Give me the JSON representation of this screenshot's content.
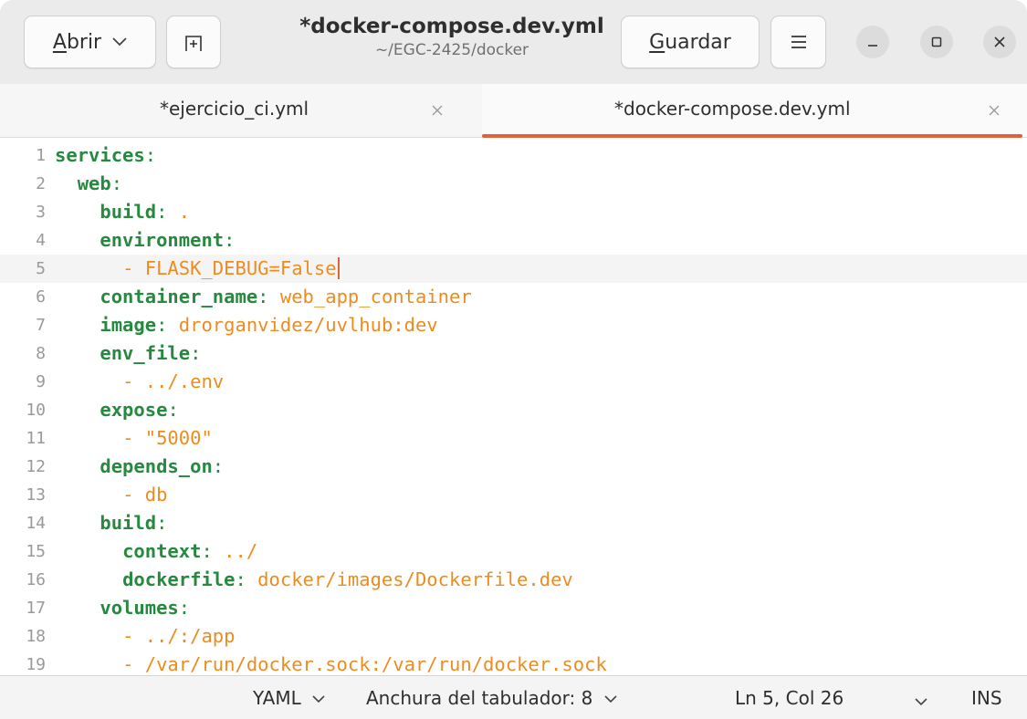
{
  "header": {
    "open_label_accel": "A",
    "open_label_rest": "brir",
    "title": "*docker-compose.dev.yml",
    "subtitle": "~/EGC-2425/docker",
    "save_label_accel": "G",
    "save_label_rest": "uardar",
    "icons": [
      "chevron-down-icon",
      "new-tab-icon",
      "hamburger-menu-icon",
      "minimize-icon",
      "maximize-icon",
      "close-icon"
    ]
  },
  "tabs": [
    {
      "label": "*ejercicio_ci.yml",
      "active": false
    },
    {
      "label": "*docker-compose.dev.yml",
      "active": true
    }
  ],
  "editor": {
    "current_line": 5,
    "lines": [
      {
        "n": "1",
        "indent": "",
        "key": "services",
        "colon": ":",
        "value": ""
      },
      {
        "n": "2",
        "indent": "  ",
        "key": "web",
        "colon": ":",
        "value": ""
      },
      {
        "n": "3",
        "indent": "    ",
        "key": "build",
        "colon": ": ",
        "value": "."
      },
      {
        "n": "4",
        "indent": "    ",
        "key": "environment",
        "colon": ":",
        "value": ""
      },
      {
        "n": "5",
        "indent": "      ",
        "key": "",
        "colon": "",
        "value": "- FLASK_DEBUG=False"
      },
      {
        "n": "6",
        "indent": "    ",
        "key": "container_name",
        "colon": ": ",
        "value": "web_app_container"
      },
      {
        "n": "7",
        "indent": "    ",
        "key": "image",
        "colon": ": ",
        "value": "drorganvidez/uvlhub:dev"
      },
      {
        "n": "8",
        "indent": "    ",
        "key": "env_file",
        "colon": ":",
        "value": ""
      },
      {
        "n": "9",
        "indent": "      ",
        "key": "",
        "colon": "",
        "value": "- ../.env"
      },
      {
        "n": "10",
        "indent": "    ",
        "key": "expose",
        "colon": ":",
        "value": ""
      },
      {
        "n": "11",
        "indent": "      ",
        "key": "",
        "colon": "",
        "value": "- \"5000\""
      },
      {
        "n": "12",
        "indent": "    ",
        "key": "depends_on",
        "colon": ":",
        "value": ""
      },
      {
        "n": "13",
        "indent": "      ",
        "key": "",
        "colon": "",
        "value": "- db"
      },
      {
        "n": "14",
        "indent": "    ",
        "key": "build",
        "colon": ":",
        "value": ""
      },
      {
        "n": "15",
        "indent": "      ",
        "key": "context",
        "colon": ": ",
        "value": "../"
      },
      {
        "n": "16",
        "indent": "      ",
        "key": "dockerfile",
        "colon": ": ",
        "value": "docker/images/Dockerfile.dev"
      },
      {
        "n": "17",
        "indent": "    ",
        "key": "volumes",
        "colon": ":",
        "value": ""
      },
      {
        "n": "18",
        "indent": "      ",
        "key": "",
        "colon": "",
        "value": "- ../:/app"
      },
      {
        "n": "19",
        "indent": "      ",
        "key": "",
        "colon": "",
        "value": "- /var/run/docker.sock:/var/run/docker.sock"
      }
    ]
  },
  "statusbar": {
    "language": "YAML",
    "tab_width": "Anchura del tabulador: 8",
    "position": "Ln 5, Col 26",
    "mode": "INS"
  },
  "colors": {
    "accent": "#e0643a",
    "yaml_key": "#26893f",
    "yaml_value": "#ec8c1f"
  }
}
